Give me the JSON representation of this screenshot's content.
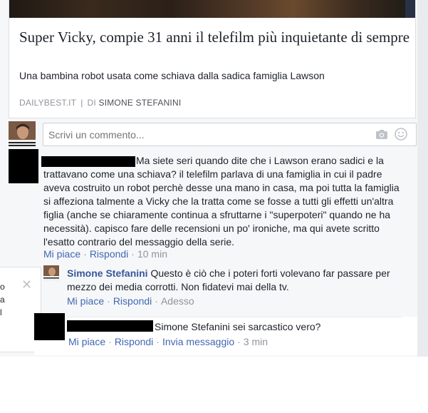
{
  "link_card": {
    "title": "Super Vicky, compie 31 anni il telefilm più inquietante di sempre",
    "description": "Una bambina robot usata come schiava dalla sadica famiglia Lawson",
    "source": "DAILYBEST.IT",
    "separator": "|",
    "author_prefix": "DI",
    "author": "SIMONE STEFANINI"
  },
  "composer": {
    "placeholder": "Scrivi un commento...",
    "icons": [
      "camera-icon",
      "smile-icon"
    ]
  },
  "comments": [
    {
      "author": "",
      "redacted": true,
      "text_lines": [
        "Ma siete seri quando dite che i Lawson erano sadici e la",
        "trattavano come una schiava? il telefilm parlava di una famiglia in cui il padre",
        "aveva costruito un robot perchè desse una mano in casa, ma poi tutta la famiglia",
        "si affeziona talmente a Vicky che la tratta come se fosse a tutti gli effetti un'altra",
        "figlia (anche se chiaramente continua a sfruttarne i \"superpoteri\" quando ne ha",
        "necessità). capisco fare delle recensioni un po' ironiche, ma qui avete scritto",
        "l'esatto contrario del messaggio della serie."
      ],
      "actions": {
        "like": "Mi piace",
        "reply": "Rispondi",
        "time": "10 min"
      }
    }
  ],
  "replies": [
    {
      "author": "Simone Stefanini",
      "text_lines": [
        "Questo è ciò che i poteri forti volevano far passare per",
        "mezzo dei media corrotti. Non fidatevi mai della tv."
      ],
      "actions": {
        "like": "Mi piace",
        "reply": "Rispondi",
        "time": "Adesso"
      }
    },
    {
      "author": "",
      "redacted": true,
      "text": "Simone Stefanini sei sarcastico vero?",
      "actions": {
        "like": "Mi piace",
        "reply": "Rispondi",
        "message": "Invia messaggio",
        "time": "3 min"
      }
    }
  ],
  "side_panel": {
    "fragments": [
      "o",
      "a",
      "l"
    ]
  }
}
